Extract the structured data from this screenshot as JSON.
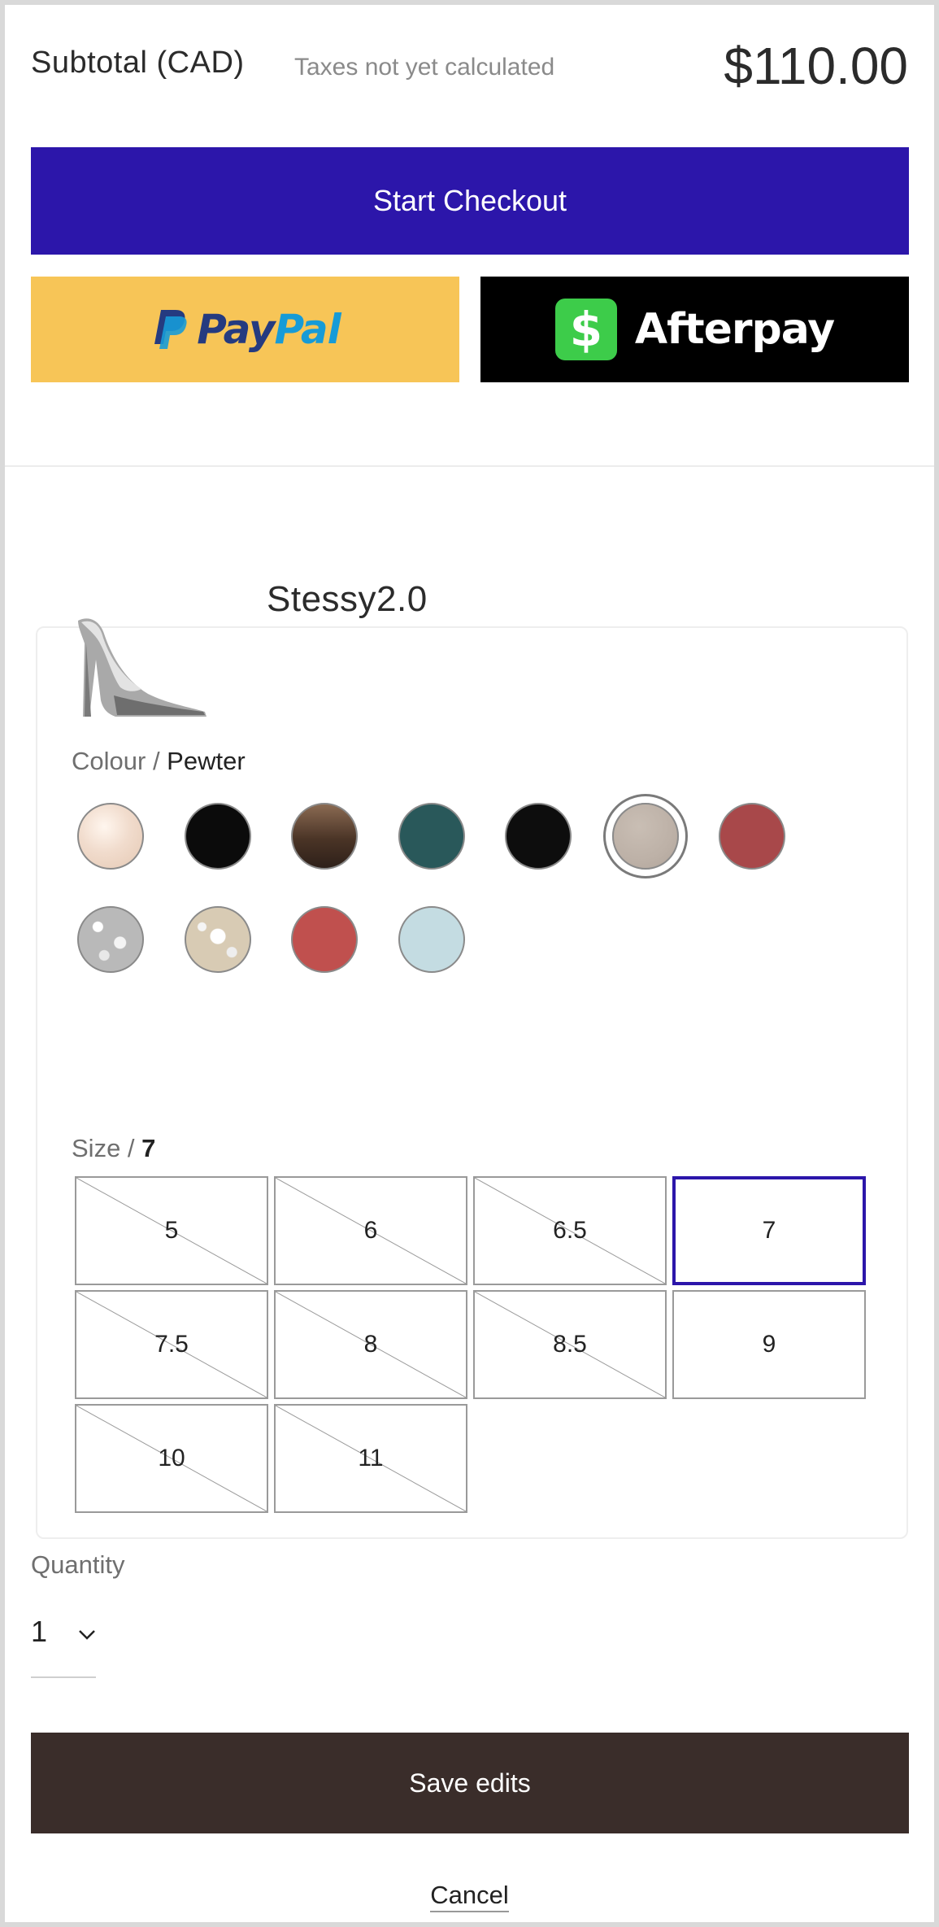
{
  "summary": {
    "subtotal_label": "Subtotal (CAD)",
    "taxes_note": "Taxes not yet calculated",
    "subtotal_value": "$110.00"
  },
  "checkout": {
    "start_label": "Start Checkout",
    "paypal_part1": "Pay",
    "paypal_part2": "Pal",
    "afterpay_label": "Afterpay",
    "afterpay_icon_glyph": "$"
  },
  "product": {
    "name": "Stessy2.0",
    "colour_label": "Colour",
    "colour_separator": " / ",
    "colour_value": "Pewter",
    "size_label": "Size",
    "size_separator": " / ",
    "size_value": "7",
    "colours": [
      {
        "name": "blush-patent",
        "hex": "#f1dccd",
        "selected": false
      },
      {
        "name": "black",
        "hex": "#0b0b0b",
        "selected": false
      },
      {
        "name": "brown",
        "hex": "#6a4f3c",
        "selected": false
      },
      {
        "name": "teal",
        "hex": "#29585a",
        "selected": false
      },
      {
        "name": "black-2",
        "hex": "#0d0d0d",
        "selected": false
      },
      {
        "name": "pewter",
        "hex": "#bdb1a7",
        "selected": true
      },
      {
        "name": "red",
        "hex": "#a8484a",
        "selected": false
      },
      {
        "name": "silver-crystal",
        "hex": "#c9c9c9",
        "selected": false
      },
      {
        "name": "gold-crystal",
        "hex": "#d8cbb4",
        "selected": false
      },
      {
        "name": "coral-red",
        "hex": "#c0504e",
        "selected": false
      },
      {
        "name": "light-blue",
        "hex": "#c4dce2",
        "selected": false
      }
    ],
    "sizes": [
      {
        "label": "5",
        "available": false,
        "selected": false
      },
      {
        "label": "6",
        "available": false,
        "selected": false
      },
      {
        "label": "6.5",
        "available": false,
        "selected": false
      },
      {
        "label": "7",
        "available": true,
        "selected": true
      },
      {
        "label": "7.5",
        "available": false,
        "selected": false
      },
      {
        "label": "8",
        "available": false,
        "selected": false
      },
      {
        "label": "8.5",
        "available": false,
        "selected": false
      },
      {
        "label": "9",
        "available": true,
        "selected": false
      },
      {
        "label": "10",
        "available": false,
        "selected": false
      },
      {
        "label": "11",
        "available": false,
        "selected": false
      }
    ]
  },
  "quantity": {
    "label": "Quantity",
    "value": "1"
  },
  "actions": {
    "save_label": "Save edits",
    "cancel_label": "Cancel"
  },
  "colors": {
    "checkout_bg": "#2c16aa",
    "paypal_bg": "#f7c557",
    "afterpay_bg": "#000000",
    "afterpay_green": "#3dcc4a",
    "save_bg": "#3a2d2a",
    "size_selected_border": "#2c16aa"
  },
  "icons": {
    "qty_dropdown": "chevron-down-icon",
    "paypal": "paypal-logo-icon",
    "afterpay": "afterpay-logo-icon"
  }
}
